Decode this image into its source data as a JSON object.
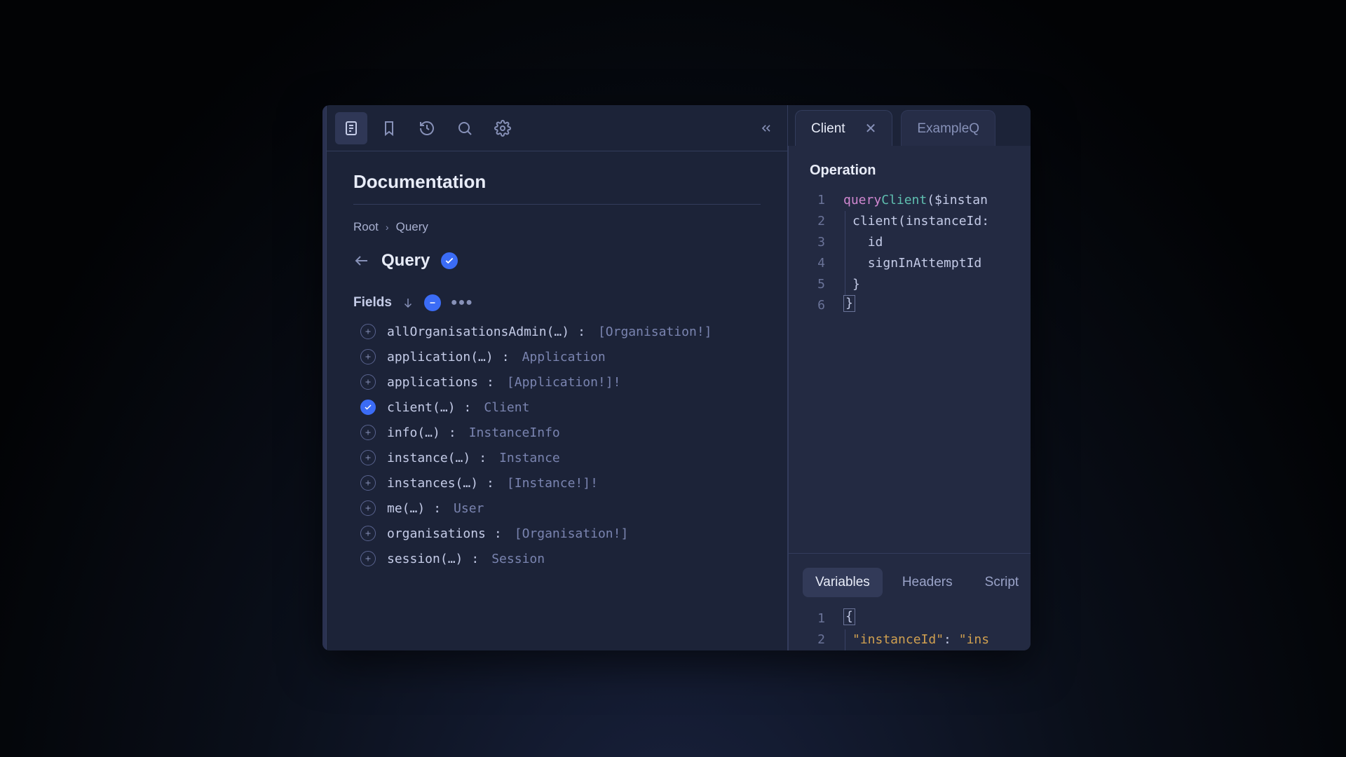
{
  "docs": {
    "title": "Documentation",
    "breadcrumb": {
      "root": "Root",
      "current": "Query"
    },
    "type": {
      "name": "Query"
    },
    "fields_label": "Fields",
    "fields": [
      {
        "name": "allOrganisationsAdmin(…)",
        "type": "[Organisation!]",
        "selected": false
      },
      {
        "name": "application(…)",
        "type": "Application",
        "selected": false
      },
      {
        "name": "applications",
        "type": "[Application!]!",
        "selected": false
      },
      {
        "name": "client(…)",
        "type": "Client",
        "selected": true
      },
      {
        "name": "info(…)",
        "type": "InstanceInfo",
        "selected": false
      },
      {
        "name": "instance(…)",
        "type": "Instance",
        "selected": false
      },
      {
        "name": "instances(…)",
        "type": "[Instance!]!",
        "selected": false
      },
      {
        "name": "me(…)",
        "type": "User",
        "selected": false
      },
      {
        "name": "organisations",
        "type": "[Organisation!]",
        "selected": false
      },
      {
        "name": "session(…)",
        "type": "Session",
        "selected": false
      }
    ]
  },
  "tabs": [
    {
      "label": "Client",
      "active": true,
      "closable": true
    },
    {
      "label": "ExampleQ",
      "active": false,
      "closable": false
    }
  ],
  "operation": {
    "label": "Operation",
    "lines": {
      "l1_kw": "query",
      "l1_name": "Client",
      "l1_rest": "($instan",
      "l2": "client(instanceId:",
      "l3": "id",
      "l4": "signInAttemptId",
      "l5": "}",
      "l6": "}"
    }
  },
  "bottom_tabs": {
    "variables": "Variables",
    "headers": "Headers",
    "script": "Script"
  },
  "variables": {
    "l1": "{",
    "l2_key": "\"instanceId\"",
    "l2_colon": ": ",
    "l2_val": "\"ins"
  }
}
